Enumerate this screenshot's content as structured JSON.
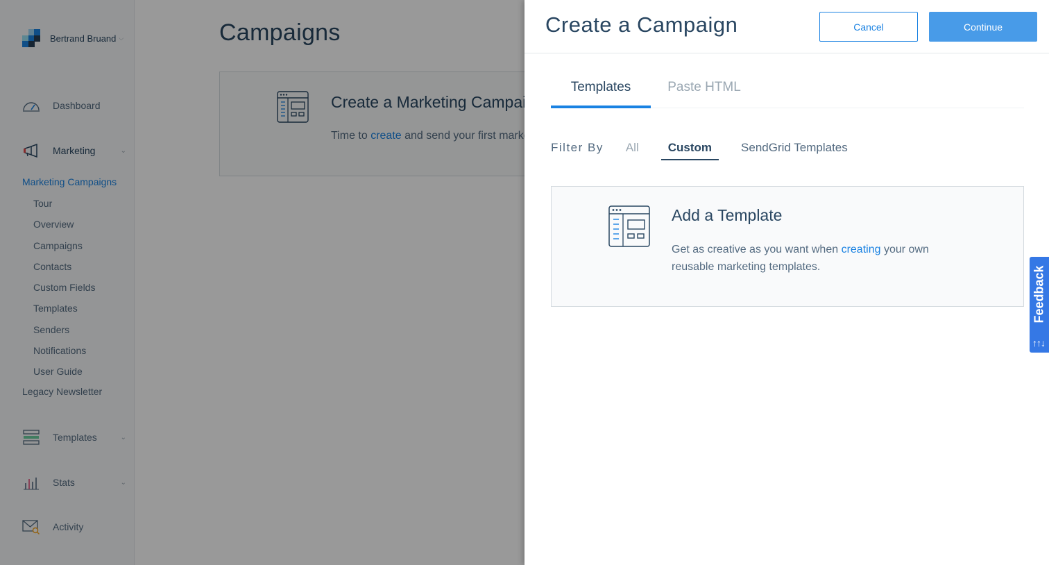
{
  "sidebar": {
    "account_name": "Bertrand Bruand",
    "nav": [
      {
        "label": "Dashboard",
        "icon": "gauge-icon"
      },
      {
        "label": "Marketing",
        "icon": "megaphone-icon"
      },
      {
        "label": "Templates",
        "icon": "templates-icon"
      },
      {
        "label": "Stats",
        "icon": "bar-chart-icon"
      },
      {
        "label": "Activity",
        "icon": "envelope-search-icon"
      }
    ],
    "section_title": "Marketing Campaigns",
    "sub_items": [
      "Tour",
      "Overview",
      "Campaigns",
      "Contacts",
      "Custom Fields",
      "Templates",
      "Senders",
      "Notifications",
      "User Guide"
    ],
    "legacy": "Legacy Newsletter"
  },
  "main": {
    "title": "Campaigns",
    "card_title": "Create a Marketing Campaig",
    "card_text_before": "Time to",
    "card_link": "create",
    "card_text_after": "and send your first marke"
  },
  "modal": {
    "title": "Create a Campaign",
    "cancel_label": "Cancel",
    "continue_label": "Continue",
    "tabs": [
      "Templates",
      "Paste HTML"
    ],
    "active_tab": "Templates",
    "filter_label": "Filter By",
    "filters": [
      "All",
      "Custom",
      "SendGrid Templates"
    ],
    "active_filter": "Custom",
    "template_card": {
      "title": "Add a Template",
      "text_before": "Get as creative as you want when",
      "link": "creating",
      "text_after": "your own reusable marketing templates."
    }
  },
  "feedback_label": "Feedback",
  "colors": {
    "accent": "#1a82e2",
    "continue_button": "#489be8",
    "text_dark": "#294661",
    "text_muted": "#546b81",
    "feedback_tab": "#3578e5"
  }
}
